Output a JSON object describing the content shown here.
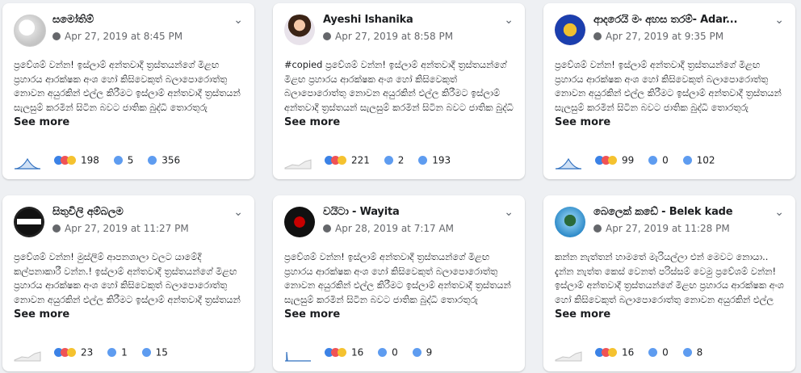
{
  "posts": [
    {
      "name": "සමෝතිම්",
      "date": "Apr 27, 2019 at 8:45 PM",
      "text": "ප්‍රවේශම් වන්න! ඉස්ලාම් අන්තවාදී ත්‍රස්තයන්ගේ මිළඟ ප්‍රහාරය ආරක්ෂක අංශ හෝ කිසිවෙකුත් බලාපොරොත්තු නොවන අයුරකින් එල්ල කිරීමට ඉස්ලාම් අන්තවාදී ත්‍රස්තයන් සැලසුම් කරමින් සිටින බවට ජාතික බුද්ධි තොරතුරු අංශයෙන් අගවමින් සිටියි....",
      "see_more": "See more",
      "likes": "198",
      "comments": "5",
      "shares": "356",
      "spark": "area"
    },
    {
      "name": "Ayeshi Ishanika",
      "date": "Apr 27, 2019 at 8:58 PM",
      "text": "#copied ප්‍රවේශම් වන්න! ඉස්ලාම් අන්තවාදී ත්‍රස්තයන්ගේ මිළඟ ප්‍රහාරය ආරක්ෂක අංශ හෝ කිසිවෙකුත් බලාපොරොත්තු නොවන අයුරකින් එල්ල කිරීමට ඉස්ලාම් අන්තවාදී ත්‍රස්තයන් සැලසුම් කරමින් සිටින බවට ජාතික බුද්ධි තොරතුරු අංශයෙන් අගවමින්....",
      "see_more": "See more",
      "likes": "221",
      "comments": "2",
      "shares": "193",
      "spark": "line"
    },
    {
      "name": "ආදරෙයි මං අහස තරම්- Adar...",
      "date": "Apr 27, 2019 at 9:35 PM",
      "text": "ප්‍රවේශම් වන්න! ඉස්ලාම් අන්තවාදී ත්‍රස්තයන්ගේ මිළඟ ප්‍රහාරය ආරක්ෂක අංශ හෝ කිසිවෙකුත් බලාපොරොත්තු නොවන අයුරකින් එල්ල කිරීමට ඉස්ලාම් අන්තවාදී ත්‍රස්තයන් සැලසුම් කරමින් සිටින බවට ජාතික බුද්ධි තොරතුරු අංශයෙන් අගවමින් සිටියි....",
      "see_more": "See more",
      "likes": "99",
      "comments": "0",
      "shares": "102",
      "spark": "area"
    },
    {
      "name": "සිතුවිලි අම්බලම",
      "date": "Apr 27, 2019 at 11:27 PM",
      "text": "ප්‍රවේශම් වන්න! මුස්ලිම් ආපනශාලා වලට යාමේදී කල්පනාකාරී වන්න.! ඉස්ලාම් අන්තවාදී ත්‍රස්තයන්ගේ මිළඟ ප්‍රහාරය ආරක්ෂක අංශ හෝ කිසිවෙකුත් බලාපොරොත්තු නොවන අයුරකින් එල්ල කිරීමට ඉස්ලාම් අන්තවාදී ත්‍රස්තයන් සැලසුම් කරමින් සිටින...",
      "see_more": "See more",
      "likes": "23",
      "comments": "1",
      "shares": "15",
      "spark": "line"
    },
    {
      "name": "වයිටා - Wayita",
      "date": "Apr 28, 2019 at 7:17 AM",
      "text": "ප්‍රවේශම් වන්න! ඉස්ලාම් අන්තවාදී ත්‍රස්තයන්ගේ මිළඟ ප්‍රහාරය ආරක්ෂක අංශ හෝ කිසිවෙකුත් බලාපොරොත්තු නොවන අයුරකින් එල්ල කිරීමට ඉස්ලාම් අන්තවාදී ත්‍රස්තයන් සැලසුම් කරමින් සිටින බවට ජාතික බුද්ධි තොරතුරු අංශයෙන් අගවමින් සිටියි....",
      "see_more": "See more",
      "likes": "16",
      "comments": "0",
      "shares": "9",
      "spark": "spike"
    },
    {
      "name": "බෙලෙක් කඩේ - Belek kade",
      "date": "Apr 27, 2019 at 11:28 PM",
      "text": "කන්න නැත්තන් හාමතේ මැරියල්ලා එන් මෙවට නොයා.. දැන්න නැත්ත කෙස් වෙනත් පරිස්සම් වෙමු ප්‍රවේශම් වන්න! ඉස්ලාම් අන්තවාදී ත්‍රස්තයන්ගේ මිළඟ ප්‍රහාරය ආරක්ෂක අංශ හෝ කිසිවෙකුත් බලාපොරොත්තු නොවන අයුරකින් එල්ල කිරීමට...",
      "see_more": "See more",
      "likes": "16",
      "comments": "0",
      "shares": "8",
      "spark": "line"
    }
  ]
}
